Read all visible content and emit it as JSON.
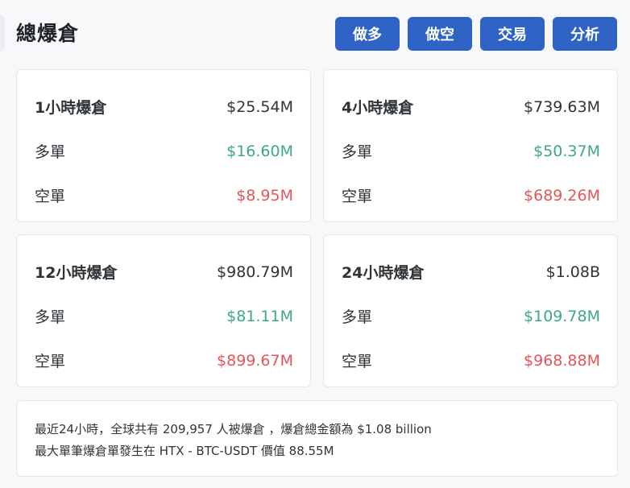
{
  "header": {
    "title": "總爆倉",
    "buttons": [
      {
        "label": "做多"
      },
      {
        "label": "做空"
      },
      {
        "label": "交易"
      },
      {
        "label": "分析"
      }
    ]
  },
  "cards": [
    {
      "title": "1小時爆倉",
      "total": "$25.54M",
      "long_label": "多單",
      "long_value": "$16.60M",
      "short_label": "空單",
      "short_value": "$8.95M"
    },
    {
      "title": "4小時爆倉",
      "total": "$739.63M",
      "long_label": "多單",
      "long_value": "$50.37M",
      "short_label": "空單",
      "short_value": "$689.26M"
    },
    {
      "title": "12小時爆倉",
      "total": "$980.79M",
      "long_label": "多單",
      "long_value": "$81.11M",
      "short_label": "空單",
      "short_value": "$899.67M"
    },
    {
      "title": "24小時爆倉",
      "total": "$1.08B",
      "long_label": "多單",
      "long_value": "$109.78M",
      "short_label": "空單",
      "short_value": "$968.88M"
    }
  ],
  "summary": {
    "line1": "最近24小時，全球共有 209,957 人被爆倉 ，爆倉總金額為 $1.08 billion",
    "line2": "最大單筆爆倉單發生在 HTX - BTC-USDT 價值 88.55M"
  },
  "colors": {
    "button_bg": "#2f63c6",
    "long_green": "#3da97f",
    "short_red": "#e45658"
  }
}
